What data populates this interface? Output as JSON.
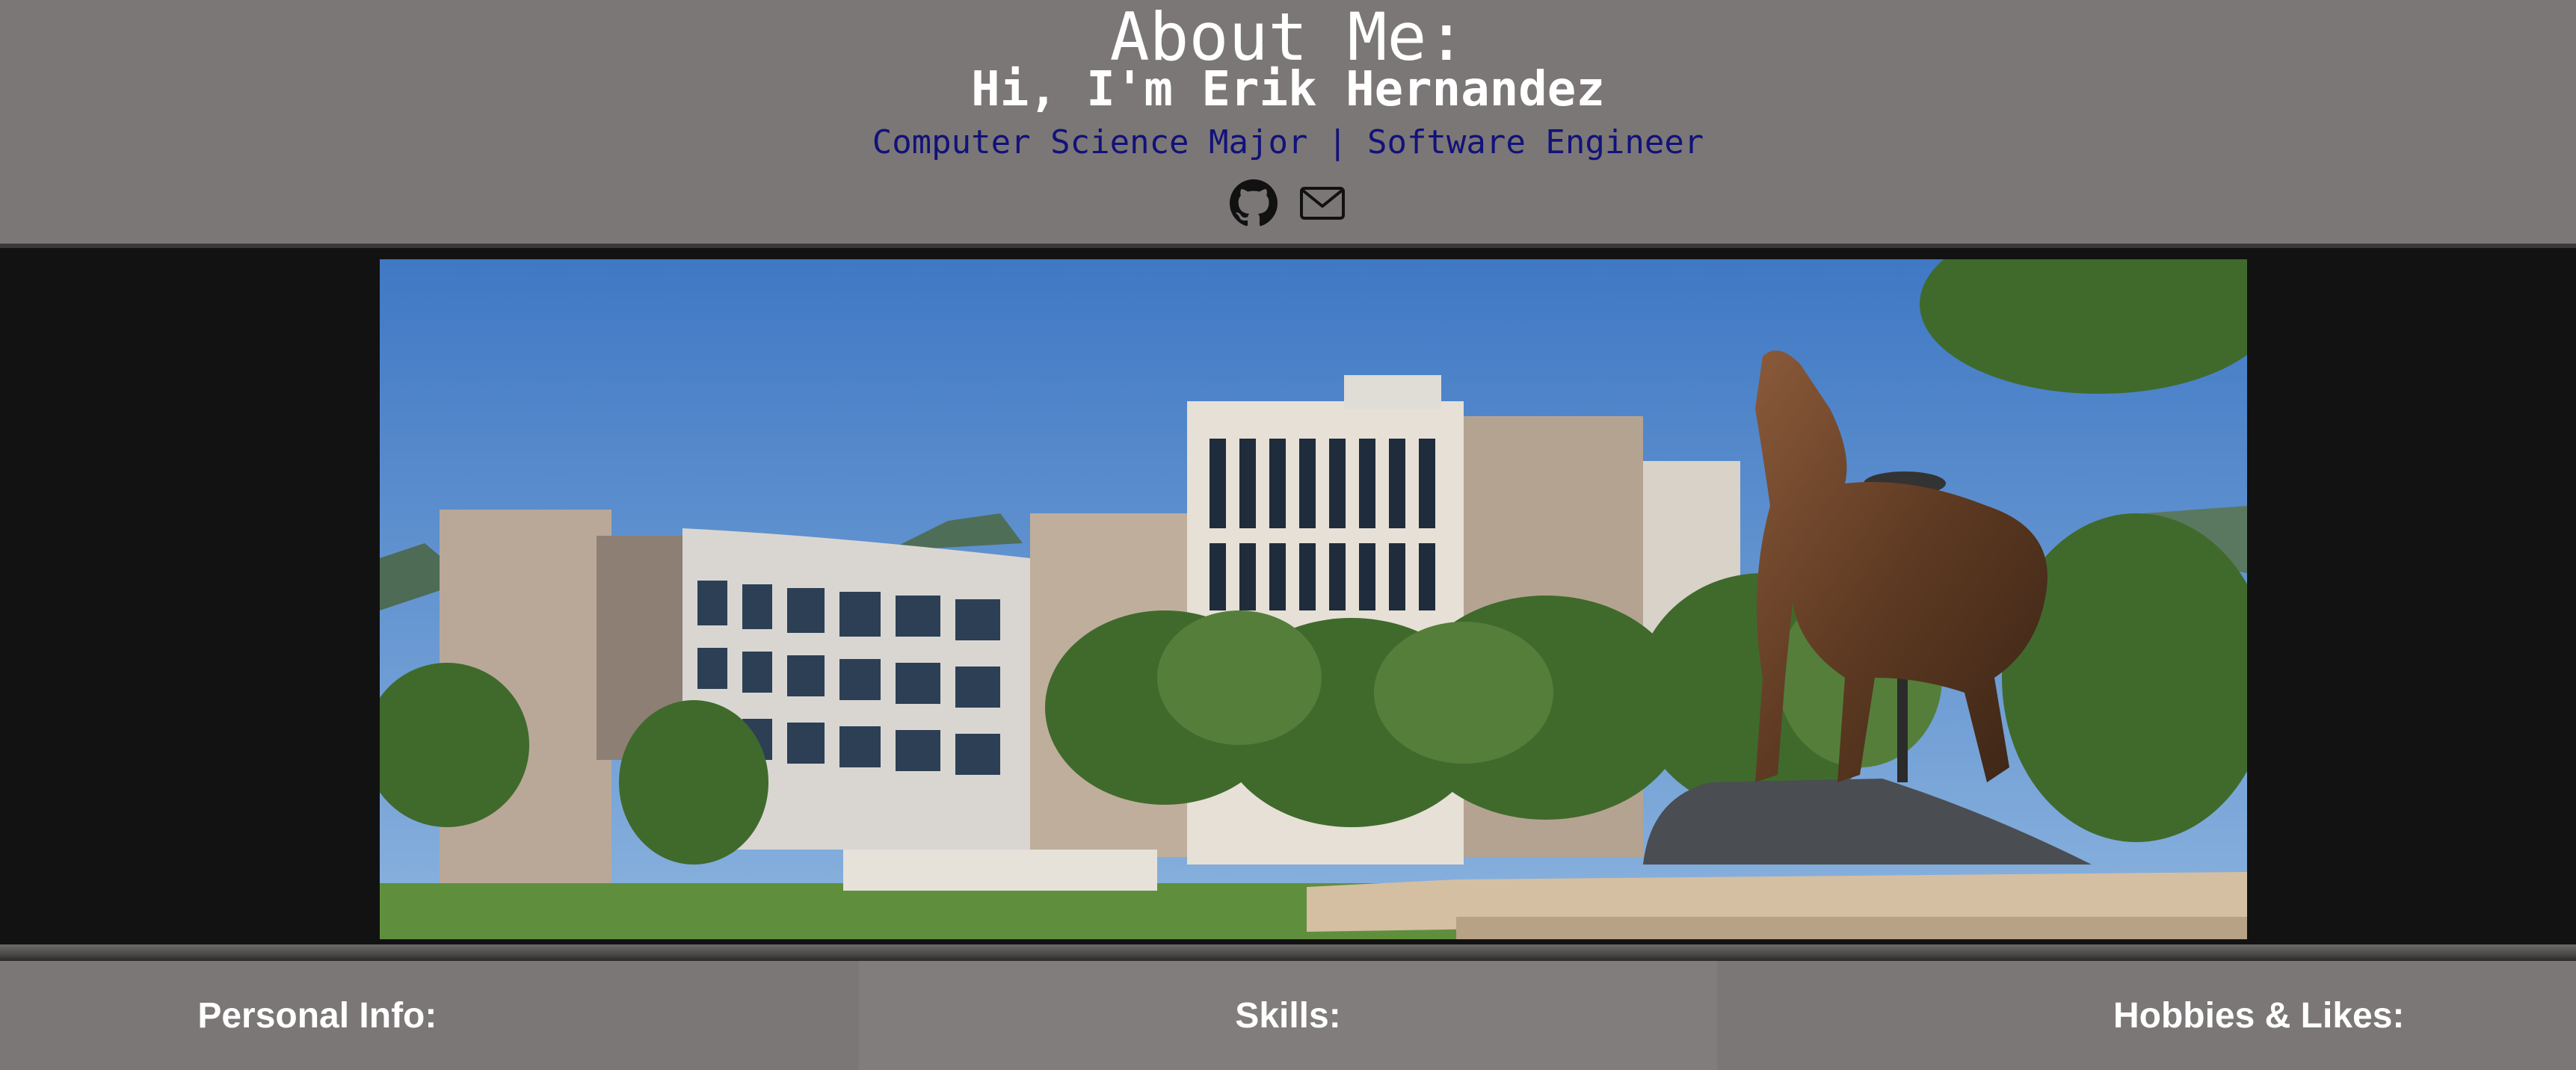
{
  "header": {
    "title": "About Me:",
    "greeting": "Hi, I'm Erik Hernandez",
    "subtitle": "Computer Science Major | Software Engineer",
    "links": [
      {
        "icon": "github-icon"
      },
      {
        "icon": "mail-icon"
      }
    ]
  },
  "hero": {
    "image": "campus-building-with-coyote-statue"
  },
  "nav": {
    "sections": [
      {
        "label": "Personal Info:"
      },
      {
        "label": "Skills:"
      },
      {
        "label": "Hobbies & Likes:"
      }
    ]
  },
  "colors": {
    "header_bg": "#7b7776",
    "page_bg": "#121212",
    "title_text": "#ffffff",
    "subtitle_text": "#12127a"
  }
}
